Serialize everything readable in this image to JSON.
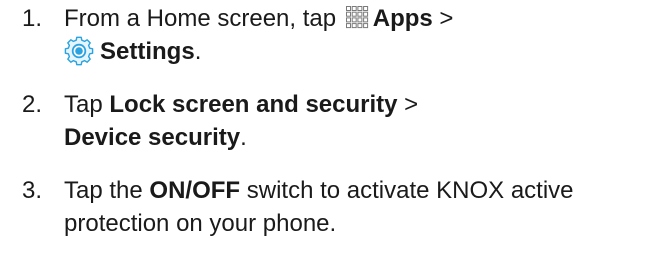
{
  "steps": [
    {
      "number": "1.",
      "line1_before_icon": "From a Home screen, tap ",
      "line1_apps": "Apps",
      "line1_sep": " >",
      "line2_settings": "Settings",
      "line2_end": "."
    },
    {
      "number": "2.",
      "text_before": "Tap ",
      "bold1": "Lock screen and security",
      "sep": " >",
      "bold2": "Device security",
      "end": "."
    },
    {
      "number": "3.",
      "text_before": "Tap the ",
      "bold1": "ON/OFF",
      "line1_after": " switch to activate KNOX active",
      "line2": "protection on your phone."
    }
  ],
  "icons": {
    "apps": "apps-grid-icon",
    "settings": "settings-gear-icon"
  },
  "colors": {
    "text": "#1a1a1a",
    "apps_icon": "#7a7a7a",
    "settings_icon": "#2aa3e0"
  }
}
